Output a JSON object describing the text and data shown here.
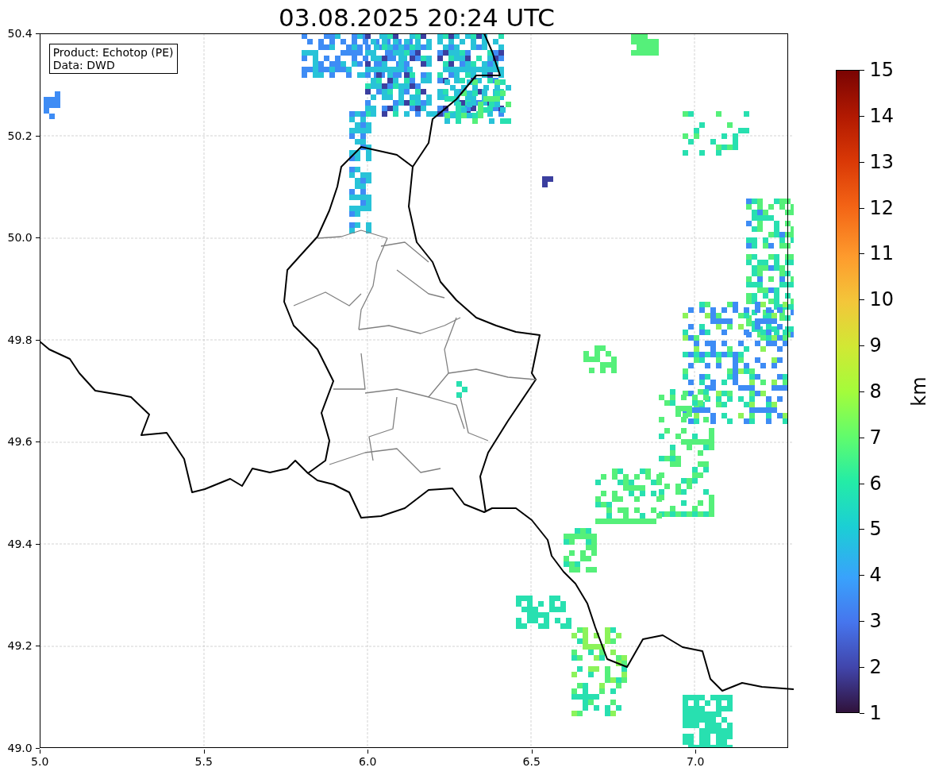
{
  "title": "03.08.2025 20:24 UTC",
  "legend": [
    "Product: Echotop (PE)",
    "Data: DWD"
  ],
  "map": {
    "y_ticks": [
      "50.4",
      "50.2",
      "50.0",
      "49.8",
      "49.6",
      "49.4",
      "49.2",
      "49.0"
    ],
    "x_ticks": [
      "5.0",
      "5.5",
      "6.0",
      "6.5",
      "7.0"
    ]
  },
  "colorbar": {
    "label": "km",
    "ticks": [
      "15",
      "14",
      "13",
      "12",
      "11",
      "10",
      "9",
      "8",
      "7",
      "6",
      "5",
      "4",
      "3",
      "2",
      "1"
    ]
  }
}
